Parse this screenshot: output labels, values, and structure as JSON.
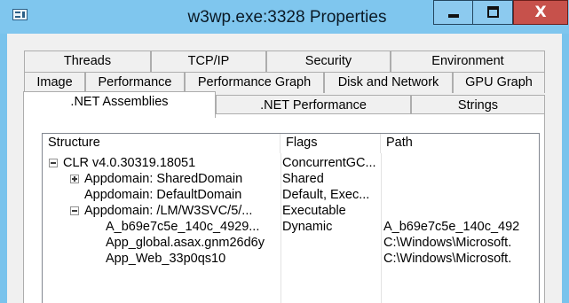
{
  "window": {
    "title": "w3wp.exe:3328 Properties",
    "close_glyph": "X",
    "accent": "#7fc6ee",
    "close_color": "#c7514b"
  },
  "tabs": {
    "row1": [
      "Threads",
      "TCP/IP",
      "Security",
      "Environment"
    ],
    "row2": [
      "Image",
      "Performance",
      "Performance Graph",
      "Disk and Network",
      "GPU Graph"
    ],
    "row3": [
      ".NET Assemblies",
      ".NET Performance",
      "Strings"
    ],
    "active": ".NET Assemblies"
  },
  "list": {
    "columns": {
      "structure": "Structure",
      "flags": "Flags",
      "path": "Path"
    },
    "rows": [
      {
        "structure": "CLR v4.0.30319.18051",
        "flags": "ConcurrentGC...",
        "path": "",
        "expander": "minus",
        "expander_icon": "collapse-icon"
      },
      {
        "structure": "Appdomain: SharedDomain",
        "flags": "Shared",
        "path": "",
        "expander": "plus",
        "expander_icon": "expand-icon"
      },
      {
        "structure": "Appdomain: DefaultDomain",
        "flags": "Default, Exec...",
        "path": "",
        "expander": "none"
      },
      {
        "structure": "Appdomain: /LM/W3SVC/5/...",
        "flags": "Executable",
        "path": "",
        "expander": "minus",
        "expander_icon": "collapse-icon"
      },
      {
        "structure": "A_b69e7c5e_140c_4929...",
        "flags": "Dynamic",
        "path": "A_b69e7c5e_140c_492",
        "expander": "none"
      },
      {
        "structure": "App_global.asax.gnm26d6y",
        "flags": "",
        "path": "C:\\Windows\\Microsoft.",
        "expander": "none"
      },
      {
        "structure": "App_Web_33p0qs10",
        "flags": "",
        "path": "C:\\Windows\\Microsoft.",
        "expander": "none"
      }
    ]
  }
}
